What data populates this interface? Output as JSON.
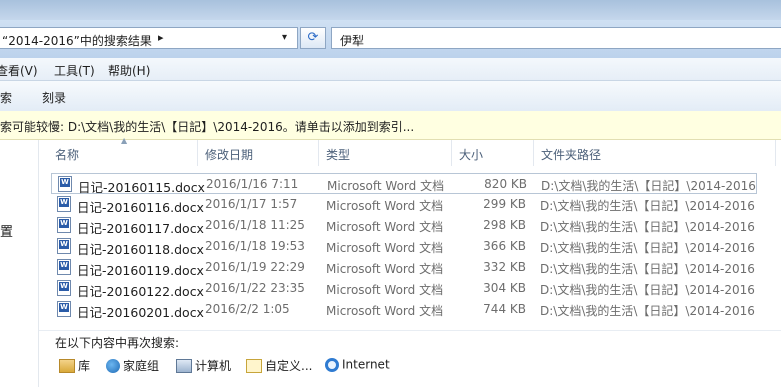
{
  "address": {
    "text": "“2014-2016”中的搜索结果",
    "arrow": "▸",
    "dropdown": "▾"
  },
  "refresh_glyph": "⟳",
  "search": {
    "value": "伊犁"
  },
  "menu": [
    "查看(V)",
    "工具(T)",
    "帮助(H)"
  ],
  "toolbar": [
    "索",
    "刻录"
  ],
  "infobar": {
    "text": "索可能较慢: D:\\文档\\我的生活\\【日記】\\2014-2016。请单击以添加到索引..."
  },
  "nav": {
    "partial_label": "置"
  },
  "columns": {
    "name": "名称",
    "date": "修改日期",
    "type": "类型",
    "size": "大小",
    "folder": "文件夹路径"
  },
  "files": [
    {
      "name": "日记-20160115.docx",
      "date": "2016/1/16 7:11",
      "type": "Microsoft Word 文档",
      "size": "820 KB",
      "folder": "D:\\文档\\我的生活\\【日記】\\2014-2016",
      "selected": true
    },
    {
      "name": "日记-20160116.docx",
      "date": "2016/1/17 1:57",
      "type": "Microsoft Word 文档",
      "size": "299 KB",
      "folder": "D:\\文档\\我的生活\\【日記】\\2014-2016"
    },
    {
      "name": "日记-20160117.docx",
      "date": "2016/1/18 11:25",
      "type": "Microsoft Word 文档",
      "size": "298 KB",
      "folder": "D:\\文档\\我的生活\\【日記】\\2014-2016"
    },
    {
      "name": "日记-20160118.docx",
      "date": "2016/1/18 19:53",
      "type": "Microsoft Word 文档",
      "size": "366 KB",
      "folder": "D:\\文档\\我的生活\\【日記】\\2014-2016"
    },
    {
      "name": "日记-20160119.docx",
      "date": "2016/1/19 22:29",
      "type": "Microsoft Word 文档",
      "size": "332 KB",
      "folder": "D:\\文档\\我的生活\\【日記】\\2014-2016"
    },
    {
      "name": "日记-20160122.docx",
      "date": "2016/1/22 23:35",
      "type": "Microsoft Word 文档",
      "size": "304 KB",
      "folder": "D:\\文档\\我的生活\\【日記】\\2014-2016"
    },
    {
      "name": "日记-20160201.docx",
      "date": "2016/2/2 1:05",
      "type": "Microsoft Word 文档",
      "size": "744 KB",
      "folder": "D:\\文档\\我的生活\\【日記】\\2014-2016"
    }
  ],
  "search_again": {
    "label": "在以下内容中再次搜索:",
    "locations": [
      {
        "label": "库",
        "icon": "library-icon"
      },
      {
        "label": "家庭组",
        "icon": "homegroup-icon"
      },
      {
        "label": "计算机",
        "icon": "computer-icon"
      },
      {
        "label": "自定义...",
        "icon": "custom-folder-icon"
      },
      {
        "label": "Internet",
        "icon": "internet-icon"
      }
    ]
  },
  "colors": {
    "selection_border": "#b8c6d6",
    "infobar_bg": "#ffffe1",
    "header_text": "#4c607a"
  }
}
